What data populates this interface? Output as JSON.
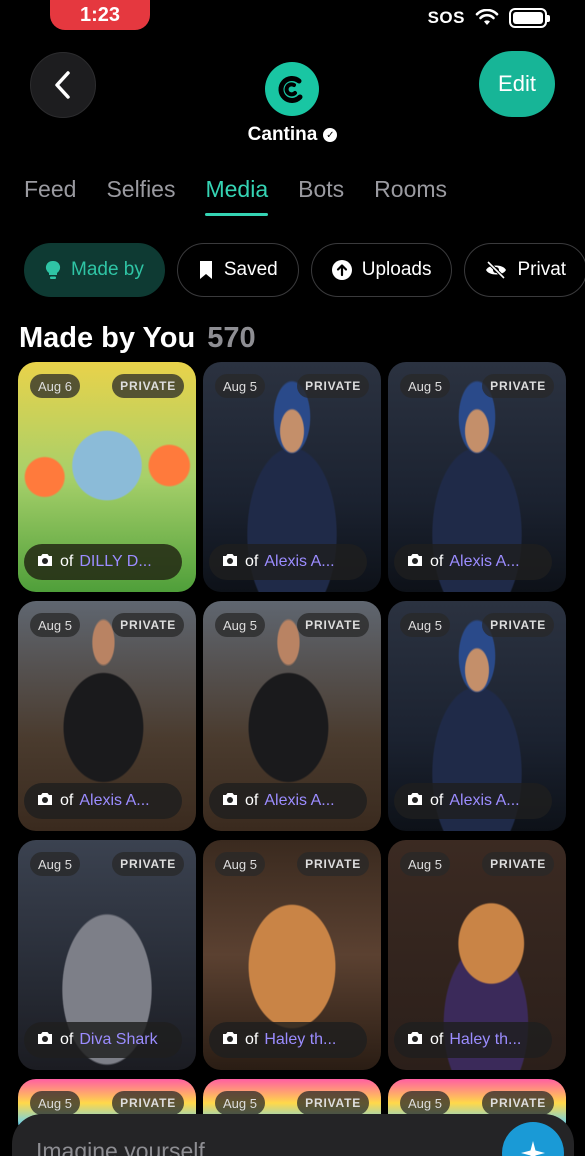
{
  "status_bar": {
    "time": "1:23",
    "sos": "SOS"
  },
  "header": {
    "profile_name": "Cantina",
    "edit_label": "Edit"
  },
  "tabs": [
    {
      "label": "Feed",
      "active": false
    },
    {
      "label": "Selfies",
      "active": false
    },
    {
      "label": "Media",
      "active": true
    },
    {
      "label": "Bots",
      "active": false
    },
    {
      "label": "Rooms",
      "active": false
    }
  ],
  "filters": [
    {
      "label": "Made by",
      "icon": "lightbulb-icon",
      "active": true
    },
    {
      "label": "Saved",
      "icon": "bookmark-icon",
      "active": false
    },
    {
      "label": "Uploads",
      "icon": "upload-icon",
      "active": false
    },
    {
      "label": "Privat",
      "icon": "eye-off-icon",
      "active": false
    }
  ],
  "section": {
    "title": "Made by You",
    "count": "570"
  },
  "cards": [
    {
      "date": "Aug 6",
      "badge": "PRIVATE",
      "of": "of",
      "name": "DILLY D...",
      "art": "dolphin"
    },
    {
      "date": "Aug 5",
      "badge": "PRIVATE",
      "of": "of",
      "name": "Alexis A...",
      "art": "hero"
    },
    {
      "date": "Aug 5",
      "badge": "PRIVATE",
      "of": "of",
      "name": "Alexis A...",
      "art": "hero"
    },
    {
      "date": "Aug 5",
      "badge": "PRIVATE",
      "of": "of",
      "name": "Alexis A...",
      "art": "jacket"
    },
    {
      "date": "Aug 5",
      "badge": "PRIVATE",
      "of": "of",
      "name": "Alexis A...",
      "art": "jacket"
    },
    {
      "date": "Aug 5",
      "badge": "PRIVATE",
      "of": "of",
      "name": "Alexis A...",
      "art": "hero"
    },
    {
      "date": "Aug 5",
      "badge": "PRIVATE",
      "of": "of",
      "name": "Diva Shark",
      "art": "shark"
    },
    {
      "date": "Aug 5",
      "badge": "PRIVATE",
      "of": "of",
      "name": "Haley th...",
      "art": "hamster"
    },
    {
      "date": "Aug 5",
      "badge": "PRIVATE",
      "of": "of",
      "name": "Haley th...",
      "art": "wizard"
    },
    {
      "date": "Aug 5",
      "badge": "PRIVATE",
      "art": "rainbow"
    },
    {
      "date": "Aug 5",
      "badge": "PRIVATE",
      "art": "rainbow"
    },
    {
      "date": "Aug 5",
      "badge": "PRIVATE",
      "art": "rainbow"
    }
  ],
  "imagine": {
    "placeholder": "Imagine yourself"
  },
  "colors": {
    "accent": "#35d4b4",
    "edit_button": "#17b597",
    "time_pill": "#e5383f",
    "name_link": "#9b8cff"
  }
}
